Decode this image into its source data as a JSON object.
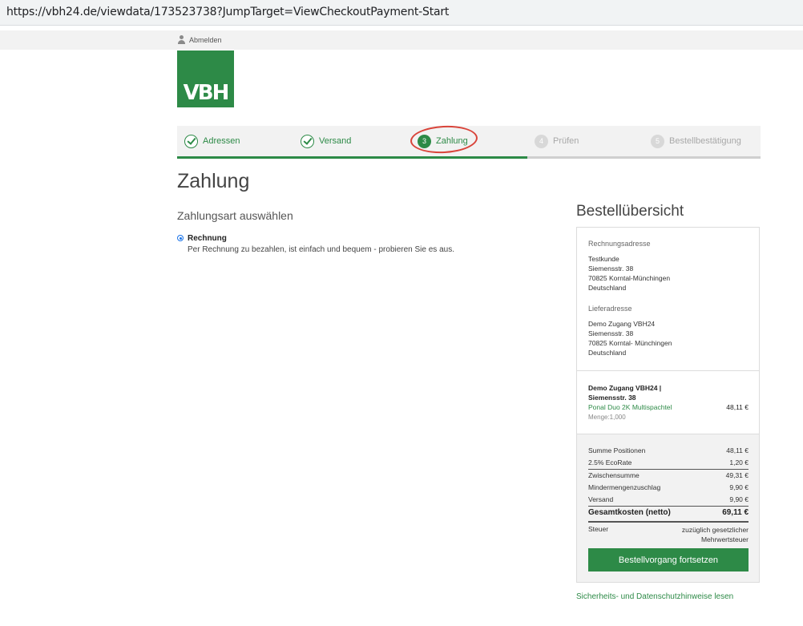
{
  "browser": {
    "url": "https://vbh24.de/viewdata/173523738?JumpTarget=ViewCheckoutPayment-Start"
  },
  "header": {
    "logout_label": "Abmelden",
    "logo_text": "VBH"
  },
  "stepper": {
    "steps": [
      {
        "number": "",
        "label": "Adressen",
        "state": "done"
      },
      {
        "number": "",
        "label": "Versand",
        "state": "done"
      },
      {
        "number": "3",
        "label": "Zahlung",
        "state": "active"
      },
      {
        "number": "4",
        "label": "Prüfen",
        "state": "inactive"
      },
      {
        "number": "5",
        "label": "Bestellbestätigung",
        "state": "inactive"
      }
    ],
    "highlight_color": "#d9443a",
    "accent_color": "#2d8a47"
  },
  "main": {
    "title": "Zahlung",
    "section_title": "Zahlungsart auswählen",
    "payment_option": {
      "name": "Rechnung",
      "description": "Per Rechnung zu bezahlen, ist einfach und bequem - probieren Sie es aus.",
      "selected": true
    }
  },
  "summary": {
    "title": "Bestellübersicht",
    "billing": {
      "heading": "Rechnungsadresse",
      "lines": [
        "Testkunde",
        "Siemensstr. 38",
        "70825  Korntal-Münchingen",
        "Deutschland"
      ]
    },
    "shipping": {
      "heading": "Lieferadresse",
      "lines": [
        "Demo Zugang VBH24",
        "Siemensstr. 38",
        "70825  Korntal- Münchingen",
        "Deutschland"
      ]
    },
    "order_group": "Demo Zugang VBH24 | Siemensstr. 38",
    "product": {
      "name": "Ponal Duo 2K Multispachtel",
      "price": "48,11 €",
      "quantity": "Menge:1,000"
    },
    "totals": [
      {
        "label": "Summe Positionen",
        "value": "48,11 €"
      },
      {
        "label": "2.5% EcoRate",
        "value": "1,20 €"
      },
      {
        "label": "Zwischensumme",
        "value": "49,31 €"
      },
      {
        "label": "Mindermengenzuschlag",
        "value": "9,90 €"
      },
      {
        "label": "Versand",
        "value": "9,90 €"
      }
    ],
    "grand_total": {
      "label": "Gesamtkosten (netto)",
      "value": "69,11 €"
    },
    "tax": {
      "label": "Steuer",
      "value": "zuzüglich gesetzlicher Mehrwertsteuer"
    },
    "continue_label": "Bestellvorgang fortsetzen"
  },
  "footer": {
    "security_link": "Sicherheits- und Datenschutzhinweise lesen"
  }
}
